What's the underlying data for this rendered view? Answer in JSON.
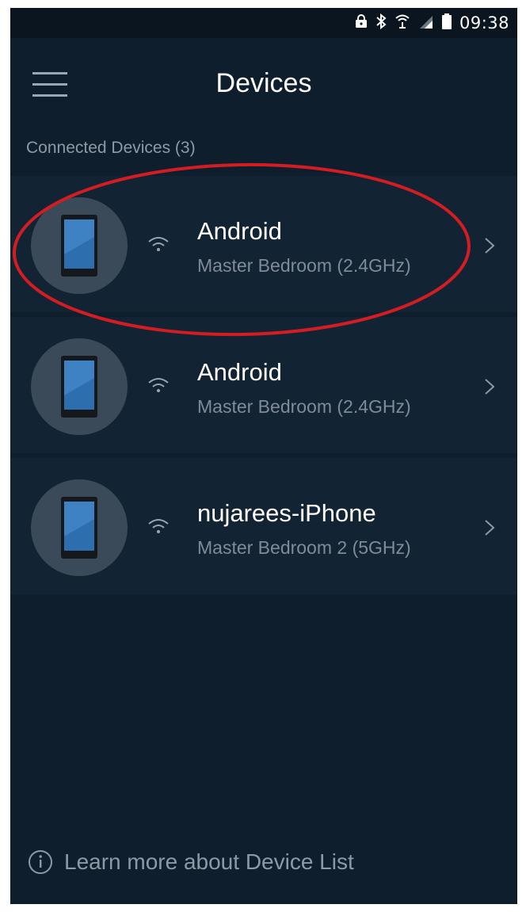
{
  "status_bar": {
    "time": "09:38",
    "icons": [
      "lock-icon",
      "bluetooth-icon",
      "wifi-icon",
      "signal-icon",
      "battery-icon"
    ]
  },
  "header": {
    "title": "Devices",
    "menu_icon": "hamburger-menu-icon"
  },
  "section": {
    "label": "Connected Devices  (3)"
  },
  "devices": [
    {
      "name": "Android",
      "location": "Master Bedroom (2.4GHz)",
      "icon": "phone-icon"
    },
    {
      "name": "Android",
      "location": "Master Bedroom (2.4GHz)",
      "icon": "phone-icon"
    },
    {
      "name": "nujarees-iPhone",
      "location": "Master Bedroom 2 (5GHz)",
      "icon": "phone-icon"
    }
  ],
  "footer": {
    "text": "Learn more about Device List",
    "icon": "info-icon"
  },
  "colors": {
    "background": "#0f1e2d",
    "row_background": "#122334",
    "avatar": "#3a4a59",
    "muted_text": "#8e99a6",
    "highlight_ring": "#d31d23"
  }
}
